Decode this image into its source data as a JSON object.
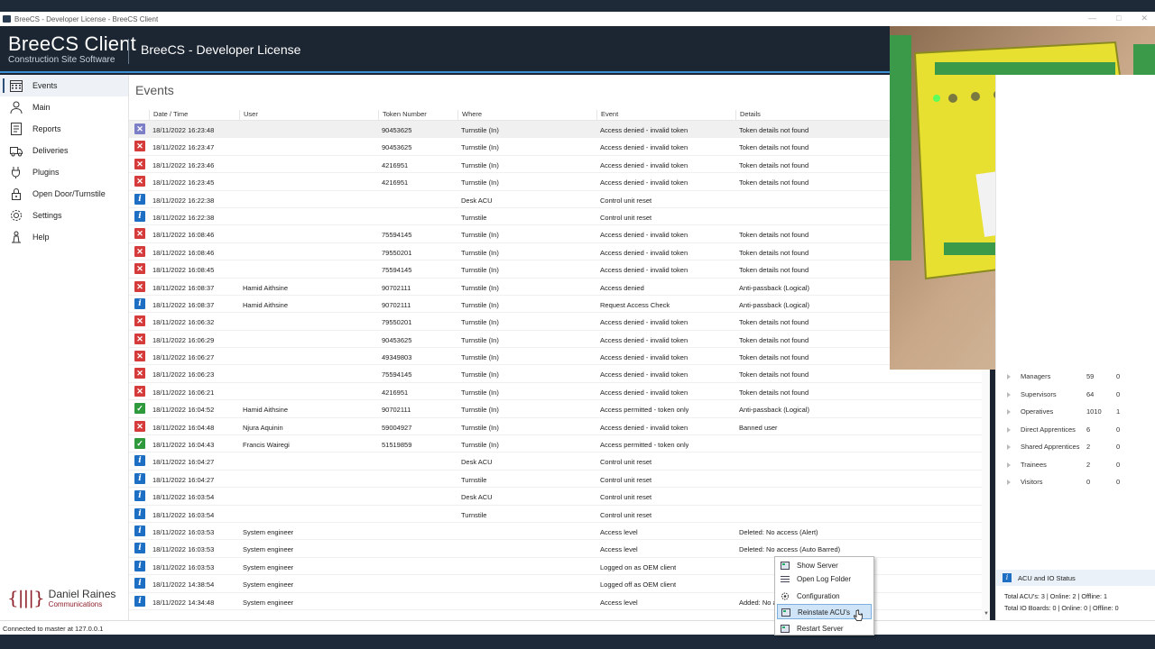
{
  "window": {
    "title": "BreeCS - Developer License - BreeCS Client"
  },
  "header": {
    "brand_name": "BreeCS Client",
    "brand_sub": "Construction Site Software",
    "title": "BreeCS - Developer License"
  },
  "sidebar": {
    "items": [
      {
        "label": "Events",
        "icon": "calendar-icon"
      },
      {
        "label": "Main",
        "icon": "person-icon"
      },
      {
        "label": "Reports",
        "icon": "report-icon"
      },
      {
        "label": "Deliveries",
        "icon": "truck-icon"
      },
      {
        "label": "Plugins",
        "icon": "plug-icon"
      },
      {
        "label": "Open Door/Turnstile",
        "icon": "lock-icon"
      },
      {
        "label": "Settings",
        "icon": "gear-icon"
      },
      {
        "label": "Help",
        "icon": "help-icon"
      }
    ],
    "logo_name": "Daniel Raines",
    "logo_sub": "Communications"
  },
  "events": {
    "title": "Events",
    "columns": [
      "Date / Time",
      "User",
      "Token Number",
      "Where",
      "Event",
      "Details"
    ],
    "rows": [
      {
        "t": "deny",
        "dt": "18/11/2022 16:23:48",
        "user": "",
        "token": "90453625",
        "where": "Turnstile (In)",
        "event": "Access denied - invalid token",
        "details": "Token details not found"
      },
      {
        "t": "deny",
        "dt": "18/11/2022 16:23:47",
        "user": "",
        "token": "90453625",
        "where": "Turnstile (In)",
        "event": "Access denied - invalid token",
        "details": "Token details not found"
      },
      {
        "t": "deny",
        "dt": "18/11/2022 16:23:46",
        "user": "",
        "token": "4216951",
        "where": "Turnstile (In)",
        "event": "Access denied - invalid token",
        "details": "Token details not found"
      },
      {
        "t": "deny",
        "dt": "18/11/2022 16:23:45",
        "user": "",
        "token": "4216951",
        "where": "Turnstile (In)",
        "event": "Access denied - invalid token",
        "details": "Token details not found"
      },
      {
        "t": "info",
        "dt": "18/11/2022 16:22:38",
        "user": "",
        "token": "",
        "where": "Desk ACU",
        "event": "Control unit reset",
        "details": ""
      },
      {
        "t": "info",
        "dt": "18/11/2022 16:22:38",
        "user": "",
        "token": "",
        "where": "Turnstile",
        "event": "Control unit reset",
        "details": ""
      },
      {
        "t": "deny",
        "dt": "18/11/2022 16:08:46",
        "user": "",
        "token": "75594145",
        "where": "Turnstile (In)",
        "event": "Access denied - invalid token",
        "details": "Token details not found"
      },
      {
        "t": "deny",
        "dt": "18/11/2022 16:08:46",
        "user": "",
        "token": "79550201",
        "where": "Turnstile (In)",
        "event": "Access denied - invalid token",
        "details": "Token details not found"
      },
      {
        "t": "deny",
        "dt": "18/11/2022 16:08:45",
        "user": "",
        "token": "75594145",
        "where": "Turnstile (In)",
        "event": "Access denied - invalid token",
        "details": "Token details not found"
      },
      {
        "t": "deny",
        "dt": "18/11/2022 16:08:37",
        "user": "Hamid Aithsine",
        "token": "90702111",
        "where": "Turnstile (In)",
        "event": "Access denied",
        "details": "Anti-passback (Logical)"
      },
      {
        "t": "info",
        "dt": "18/11/2022 16:08:37",
        "user": "Hamid Aithsine",
        "token": "90702111",
        "where": "Turnstile (In)",
        "event": "Request Access Check",
        "details": "Anti-passback (Logical)"
      },
      {
        "t": "deny",
        "dt": "18/11/2022 16:06:32",
        "user": "",
        "token": "79550201",
        "where": "Turnstile (In)",
        "event": "Access denied - invalid token",
        "details": "Token details not found"
      },
      {
        "t": "deny",
        "dt": "18/11/2022 16:06:29",
        "user": "",
        "token": "90453625",
        "where": "Turnstile (In)",
        "event": "Access denied - invalid token",
        "details": "Token details not found"
      },
      {
        "t": "deny",
        "dt": "18/11/2022 16:06:27",
        "user": "",
        "token": "49349803",
        "where": "Turnstile (In)",
        "event": "Access denied - invalid token",
        "details": "Token details not found"
      },
      {
        "t": "deny",
        "dt": "18/11/2022 16:06:23",
        "user": "",
        "token": "75594145",
        "where": "Turnstile (In)",
        "event": "Access denied - invalid token",
        "details": "Token details not found"
      },
      {
        "t": "deny",
        "dt": "18/11/2022 16:06:21",
        "user": "",
        "token": "4216951",
        "where": "Turnstile (In)",
        "event": "Access denied - invalid token",
        "details": "Token details not found"
      },
      {
        "t": "ok",
        "dt": "18/11/2022 16:04:52",
        "user": "Hamid Aithsine",
        "token": "90702111",
        "where": "Turnstile (In)",
        "event": "Access permitted - token only",
        "details": "Anti-passback (Logical)"
      },
      {
        "t": "deny",
        "dt": "18/11/2022 16:04:48",
        "user": "Njura Aquinin",
        "token": "59004927",
        "where": "Turnstile (In)",
        "event": "Access denied - invalid token",
        "details": "Banned user"
      },
      {
        "t": "ok",
        "dt": "18/11/2022 16:04:43",
        "user": "Francis Wairegi",
        "token": "51519859",
        "where": "Turnstile (In)",
        "event": "Access permitted - token only",
        "details": ""
      },
      {
        "t": "info",
        "dt": "18/11/2022 16:04:27",
        "user": "",
        "token": "",
        "where": "Desk ACU",
        "event": "Control unit reset",
        "details": ""
      },
      {
        "t": "info",
        "dt": "18/11/2022 16:04:27",
        "user": "",
        "token": "",
        "where": "Turnstile",
        "event": "Control unit reset",
        "details": ""
      },
      {
        "t": "info",
        "dt": "18/11/2022 16:03:54",
        "user": "",
        "token": "",
        "where": "Desk ACU",
        "event": "Control unit reset",
        "details": ""
      },
      {
        "t": "info",
        "dt": "18/11/2022 16:03:54",
        "user": "",
        "token": "",
        "where": "Turnstile",
        "event": "Control unit reset",
        "details": ""
      },
      {
        "t": "info",
        "dt": "18/11/2022 16:03:53",
        "user": "System engineer",
        "token": "",
        "where": "",
        "event": "Access level",
        "details": "Deleted: No access (Alert)"
      },
      {
        "t": "info",
        "dt": "18/11/2022 16:03:53",
        "user": "System engineer",
        "token": "",
        "where": "",
        "event": "Access level",
        "details": "Deleted: No access (Auto Barred)"
      },
      {
        "t": "info",
        "dt": "18/11/2022 16:03:53",
        "user": "System engineer",
        "token": "",
        "where": "",
        "event": "Logged on as OEM client",
        "details": ""
      },
      {
        "t": "info",
        "dt": "18/11/2022 14:38:54",
        "user": "System engineer",
        "token": "",
        "where": "",
        "event": "Logged off as OEM client",
        "details": ""
      },
      {
        "t": "info",
        "dt": "18/11/2022 14:34:48",
        "user": "System engineer",
        "token": "",
        "where": "",
        "event": "Access level",
        "details": "Added: No a"
      }
    ]
  },
  "stats": [
    {
      "label": "Managers",
      "a": "59",
      "b": "0"
    },
    {
      "label": "Supervisors",
      "a": "64",
      "b": "0"
    },
    {
      "label": "Operatives",
      "a": "1010",
      "b": "1"
    },
    {
      "label": "Direct Apprentices",
      "a": "6",
      "b": "0"
    },
    {
      "label": "Shared Apprentices",
      "a": "2",
      "b": "0"
    },
    {
      "label": "Trainees",
      "a": "2",
      "b": "0"
    },
    {
      "label": "Visitors",
      "a": "0",
      "b": "0"
    }
  ],
  "acu_status": {
    "title": "ACU and IO Status",
    "line1": "Total ACU's: 3 | Online: 2 | Offline: 1",
    "line2": "Total IO Boards: 0 | Online: 0 | Offline: 0"
  },
  "context_menu": {
    "items": [
      "Show Server",
      "Open Log Folder",
      "Configuration",
      "Reinstate ACU's",
      "Restart Server"
    ]
  },
  "status": "Connected to master at 127.0.0.1",
  "colors": {
    "deny": "#d63b3b",
    "info": "#1d6fc4",
    "ok": "#2e9a3c",
    "header": "#1c2532"
  }
}
